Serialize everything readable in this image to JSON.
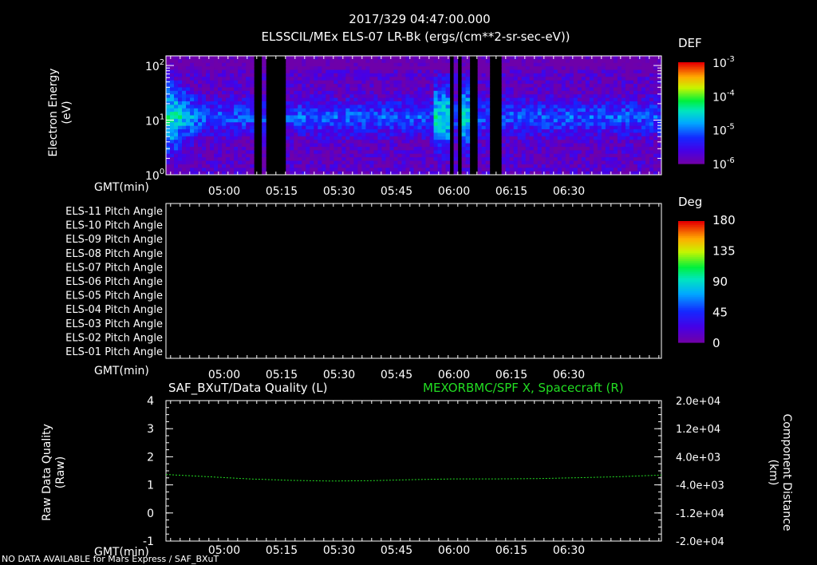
{
  "header": {
    "timestamp": "2017/329 04:47:00.000",
    "title": "ELSSCIL/MEx ELS-07 LR-Bk  (ergs/(cm**2-sr-sec-eV))"
  },
  "time_axis": {
    "label": "GMT(min)",
    "ticks": [
      "05:00",
      "05:15",
      "05:30",
      "05:45",
      "06:00",
      "06:15",
      "06:30"
    ]
  },
  "footer_note": "NO DATA AVAILABLE for Mars Express / SAF_BXuT",
  "colors": {
    "background": "#000000",
    "axes": "#ffffff",
    "trace": "#22dd22"
  },
  "chart_data": [
    {
      "type": "heatmap",
      "ylabel": "Electron Energy\n(eV)",
      "xlabel": "GMT(min)",
      "x_ticks": [
        "05:00",
        "05:15",
        "05:30",
        "05:45",
        "06:00",
        "06:15",
        "06:30"
      ],
      "y_scale": "log",
      "ylim": [
        1,
        150
      ],
      "y_tick_labels": [
        "10^0",
        "10^1",
        "10^2"
      ],
      "colorbar": {
        "title": "DEF",
        "scale": "log",
        "range": [
          1e-06,
          0.001
        ],
        "tick_labels": [
          {
            "base": "10",
            "exp": "-3"
          },
          {
            "base": "10",
            "exp": "-4"
          },
          {
            "base": "10",
            "exp": "-5"
          },
          {
            "base": "10",
            "exp": "-6"
          }
        ]
      },
      "data_gaps_minutes": [
        21,
        22,
        24,
        25,
        26,
        27,
        28,
        68,
        70,
        73,
        74,
        78,
        79,
        80
      ]
    },
    {
      "type": "heatmap",
      "xlabel": "GMT(min)",
      "x_ticks": [
        "05:00",
        "05:15",
        "05:30",
        "05:45",
        "06:00",
        "06:15",
        "06:30"
      ],
      "rows": [
        "ELS-11 Pitch Angle",
        "ELS-10 Pitch Angle",
        "ELS-09 Pitch Angle",
        "ELS-08 Pitch Angle",
        "ELS-07 Pitch Angle",
        "ELS-06 Pitch Angle",
        "ELS-05 Pitch Angle",
        "ELS-04 Pitch Angle",
        "ELS-03 Pitch Angle",
        "ELS-02 Pitch Angle",
        "ELS-01 Pitch Angle"
      ],
      "colorbar": {
        "title": "Deg",
        "range": [
          0,
          180
        ],
        "tick_labels": [
          "180",
          "135",
          "90",
          "45",
          "0"
        ]
      }
    },
    {
      "type": "line",
      "title_left": "SAF_BXuT/Data Quality (L)",
      "title_right": "MEXORBMC/SPF X, Spacecraft (R)",
      "xlabel": "GMT(min)",
      "x_ticks": [
        "05:00",
        "05:15",
        "05:30",
        "05:45",
        "06:00",
        "06:15",
        "06:30"
      ],
      "ylabel_left": "Raw Data Quality\n(Raw)",
      "ylim_left": [
        -1,
        4
      ],
      "y_ticks_left": [
        "4",
        "3",
        "2",
        "1",
        "0",
        "-1"
      ],
      "ylabel_right": "Component Distance\n(km)",
      "ylim_right": [
        -20000,
        20000
      ],
      "y_ticks_right": [
        "2.0e+04",
        "1.2e+04",
        "4.0e+03",
        "-4.0e+03",
        "-1.2e+04",
        "-2.0e+04"
      ],
      "series": [
        {
          "name": "MEXORBMC/SPF X, Spacecraft (R)",
          "x_minutes": [
            0,
            10,
            20,
            30,
            40,
            50,
            60,
            70,
            80,
            90,
            100,
            110,
            120
          ],
          "values": [
            -1050,
            -1650,
            -2300,
            -2700,
            -2900,
            -2800,
            -2500,
            -2300,
            -2300,
            -2200,
            -1950,
            -1650,
            -1200
          ]
        }
      ]
    }
  ]
}
